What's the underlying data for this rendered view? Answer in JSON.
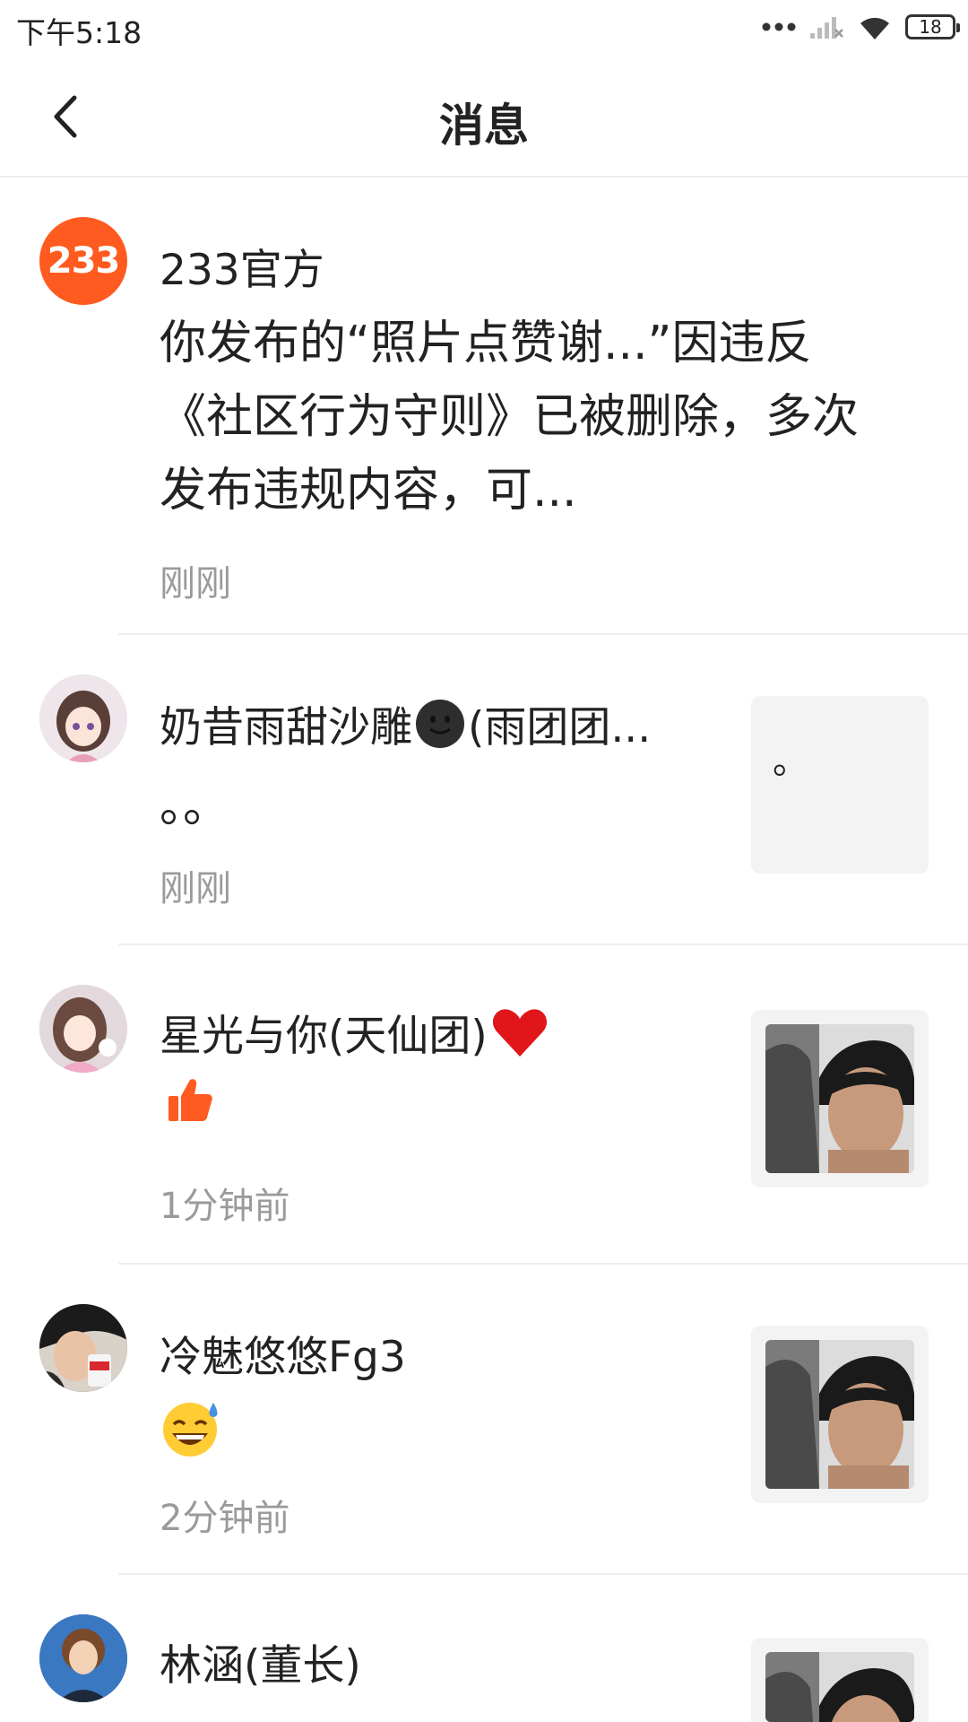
{
  "status_bar": {
    "time": "下午5:18",
    "battery": "18"
  },
  "header": {
    "title": "消息"
  },
  "messages": [
    {
      "sender": "233官方",
      "avatar_text": "233",
      "content": "你发布的“照片点赞谢...”因违反《社区行为守则》已被删除，多次发布违规内容，可...",
      "time": "刚刚"
    },
    {
      "sender": "奶昔雨甜沙雕",
      "sender_suffix": "(雨团团...",
      "content": "。。",
      "time": "刚刚",
      "thumb_text": "。"
    },
    {
      "sender": "星光与你(天仙团)",
      "content_icon": "thumbs-up-icon",
      "time": "1分钟前"
    },
    {
      "sender": "冷魅悠悠Fg3",
      "content_icon": "grinning-sweat-emoji",
      "time": "2分钟前"
    },
    {
      "sender": "林涵(董长)"
    }
  ],
  "colors": {
    "accent": "#ff6a21",
    "secondary_text": "#9a9a9a",
    "divider": "#eeeeee"
  }
}
